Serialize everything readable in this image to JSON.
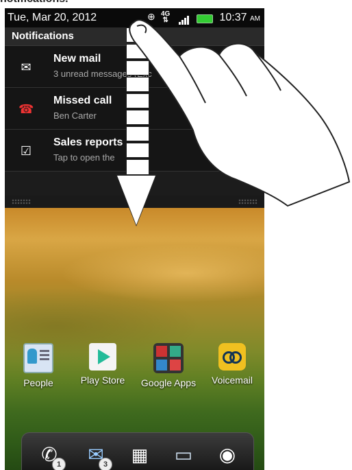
{
  "caption": "notifications.",
  "status_bar": {
    "date": "Tue, Mar 20, 2012",
    "network": "4G",
    "time": "10:37",
    "ampm": "AM"
  },
  "notifications": {
    "header": "Notifications",
    "items": [
      {
        "icon": "mail-icon",
        "title": "New mail",
        "subtitle": "3 unread messages (Exc"
      },
      {
        "icon": "missed-call-icon",
        "title": "Missed call",
        "subtitle": "Ben Carter"
      },
      {
        "icon": "checkbox-icon",
        "title": "Sales reports",
        "subtitle": "Tap to open the"
      }
    ]
  },
  "apps": [
    {
      "label": "People",
      "icon": "people-icon"
    },
    {
      "label": "Play Store",
      "icon": "play-store-icon"
    },
    {
      "label": "Google Apps",
      "icon": "google-apps-icon"
    },
    {
      "label": "Voicemail",
      "icon": "voicemail-icon"
    }
  ],
  "dock": [
    {
      "icon": "phone-icon",
      "badge": "1"
    },
    {
      "icon": "mail-icon",
      "badge": "3"
    },
    {
      "icon": "app-grid-icon",
      "badge": ""
    },
    {
      "icon": "messages-icon",
      "badge": ""
    },
    {
      "icon": "camera-icon",
      "badge": ""
    }
  ]
}
